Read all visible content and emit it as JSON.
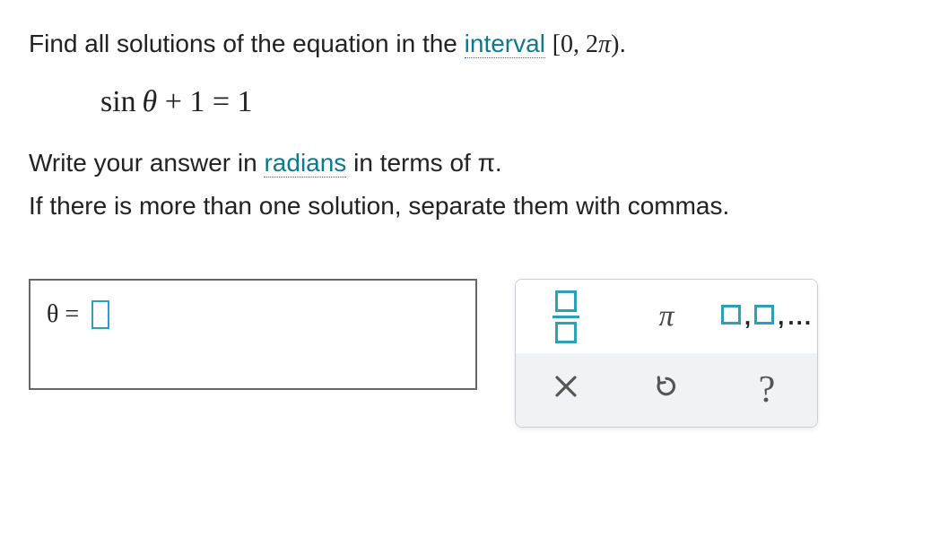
{
  "prompt": {
    "line1_pre": "Find all solutions of the equation in the ",
    "interval_word": "interval",
    "interval_expr": "[0, 2π)",
    "line1_end": "."
  },
  "equation": "sin θ + 1 = 1",
  "instructions": {
    "line2_pre": "Write your answer in ",
    "radians_word": "radians",
    "line2_post": " in terms of π.",
    "line3": "If there is more than one solution, separate them with commas."
  },
  "answer": {
    "label": "θ =",
    "value": ""
  },
  "keypad": {
    "fraction": "fraction",
    "pi": "π",
    "list": "list",
    "clear": "clear",
    "reset": "reset",
    "help": "?"
  }
}
